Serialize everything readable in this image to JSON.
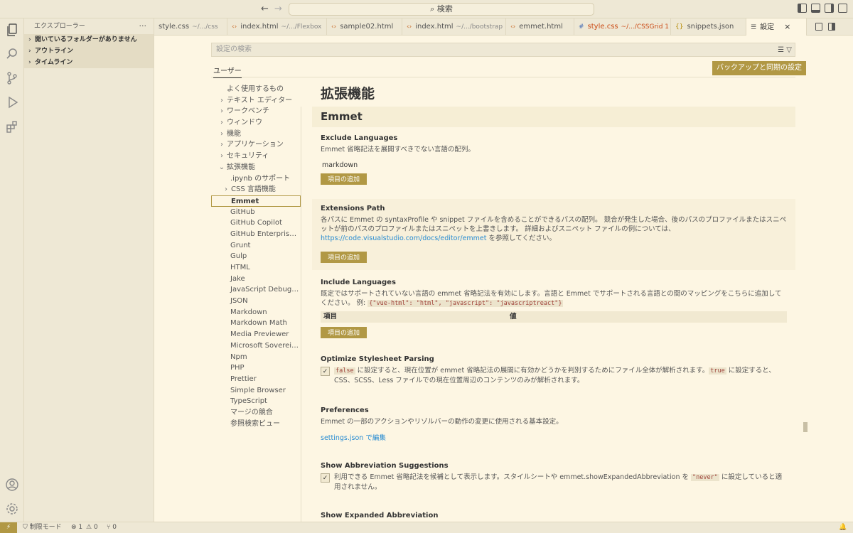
{
  "titlebar": {
    "back_arrow": "←",
    "forward_arrow": "→",
    "search_label": "⌕ 検索"
  },
  "sidebar": {
    "title": "エクスプローラー",
    "more": "···",
    "sections": [
      {
        "label": "開いているフォルダーがありません"
      },
      {
        "label": "アウトライン"
      },
      {
        "label": "タイムライン"
      }
    ]
  },
  "tabs": [
    {
      "icon": "",
      "label": "style.css",
      "path": "~/.../css",
      "status": "normal"
    },
    {
      "icon": "‹›",
      "label": "index.html",
      "path": "~/.../Flexbox",
      "status": "normal"
    },
    {
      "icon": "‹›",
      "label": "sample02.html",
      "path": "",
      "status": "normal"
    },
    {
      "icon": "‹›",
      "label": "index.html",
      "path": "~/.../bootstrap",
      "status": "normal"
    },
    {
      "icon": "‹›",
      "label": "emmet.html",
      "path": "",
      "status": "normal"
    },
    {
      "icon": "#",
      "label": "style.css",
      "path": "~/.../CSSGrid 1",
      "status": "error"
    },
    {
      "icon": "{}",
      "label": "snippets.json",
      "path": "",
      "status": "normal"
    },
    {
      "icon": "☰",
      "label": "設定",
      "path": "",
      "status": "active",
      "close": "×"
    }
  ],
  "settings": {
    "search_placeholder": "設定の検索",
    "user_tab": "ユーザー",
    "backup_button": "バックアップと同期の設定",
    "toc": [
      {
        "label": "よく使用するもの",
        "chevron": "",
        "indent": 0
      },
      {
        "label": "テキスト エディター",
        "chevron": "›",
        "indent": 0
      },
      {
        "label": "ワークベンチ",
        "chevron": "›",
        "indent": 0
      },
      {
        "label": "ウィンドウ",
        "chevron": "›",
        "indent": 0
      },
      {
        "label": "機能",
        "chevron": "›",
        "indent": 0
      },
      {
        "label": "アプリケーション",
        "chevron": "›",
        "indent": 0
      },
      {
        "label": "セキュリティ",
        "chevron": "›",
        "indent": 0
      },
      {
        "label": "拡張機能",
        "chevron": "⌄",
        "indent": 0
      },
      {
        "label": ".ipynb のサポート",
        "chevron": "",
        "indent": 1
      },
      {
        "label": "CSS 言語機能",
        "chevron": "›",
        "indent": 1
      },
      {
        "label": "Emmet",
        "chevron": "",
        "indent": 1,
        "active": true
      },
      {
        "label": "GitHub",
        "chevron": "",
        "indent": 1
      },
      {
        "label": "GitHub Copilot",
        "chevron": "",
        "indent": 1
      },
      {
        "label": "GitHub Enterprise Se...",
        "chevron": "",
        "indent": 1
      },
      {
        "label": "Grunt",
        "chevron": "",
        "indent": 1
      },
      {
        "label": "Gulp",
        "chevron": "",
        "indent": 1
      },
      {
        "label": "HTML",
        "chevron": "",
        "indent": 1
      },
      {
        "label": "Jake",
        "chevron": "",
        "indent": 1
      },
      {
        "label": "JavaScript Debugger",
        "chevron": "",
        "indent": 1
      },
      {
        "label": "JSON",
        "chevron": "",
        "indent": 1
      },
      {
        "label": "Markdown",
        "chevron": "",
        "indent": 1
      },
      {
        "label": "Markdown Math",
        "chevron": "",
        "indent": 1
      },
      {
        "label": "Media Previewer",
        "chevron": "",
        "indent": 1
      },
      {
        "label": "Microsoft Sovereign ...",
        "chevron": "",
        "indent": 1
      },
      {
        "label": "Npm",
        "chevron": "",
        "indent": 1
      },
      {
        "label": "PHP",
        "chevron": "",
        "indent": 1
      },
      {
        "label": "Prettier",
        "chevron": "",
        "indent": 1
      },
      {
        "label": "Simple Browser",
        "chevron": "",
        "indent": 1
      },
      {
        "label": "TypeScript",
        "chevron": "",
        "indent": 1
      },
      {
        "label": "マージの競合",
        "chevron": "",
        "indent": 1
      },
      {
        "label": "参照検索ビュー",
        "chevron": "",
        "indent": 1
      }
    ],
    "heading": "拡張機能",
    "section": "Emmet",
    "exclude": {
      "title": "Exclude Languages",
      "desc": "Emmet 省略記法を展開すべきでない言語の配列。",
      "value": "markdown",
      "button": "項目の追加"
    },
    "extensions_path": {
      "title": "Extensions Path",
      "desc": "各パスに Emmet の syntaxProfile や snippet ファイルを含めることができるパスの配列。 競合が発生した場合、後のパスのプロファイルまたはスニペットが前のパスのプロファイルまたはスニペットを上書きします。 詳細およびスニペット ファイルの例については、",
      "link": "https://code.visualstudio.com/docs/editor/emmet",
      "link_suffix": " を参照してください。",
      "button": "項目の追加"
    },
    "include": {
      "title": "Include Languages",
      "desc": "既定ではサポートされていない言語の emmet 省略記法を有効にします。言語と Emmet でサポートされる言語との間のマッピングをこちらに追加してください。 例: ",
      "example": "{\"vue-html\": \"html\", \"javascript\": \"javascriptreact\"}",
      "col_item": "項目",
      "col_value": "値",
      "button": "項目の追加"
    },
    "optimize": {
      "title": "Optimize Stylesheet Parsing",
      "checked": "✓",
      "code_false": "false",
      "desc_mid": " に設定すると、現在位置が emmet 省略記法の展開に有効かどうかを判別するためにファイル全体が解析されます。",
      "code_true": "true",
      "desc_end": " に設定すると、CSS、SCSS、Less ファイルでの現在位置周辺のコンテンツのみが解析されます。"
    },
    "preferences": {
      "title": "Preferences",
      "desc": "Emmet の一部のアクションやリゾルバーの動作の変更に使用される基本設定。",
      "link": "settings.json で編集"
    },
    "suggestions": {
      "title": "Show Abbreviation Suggestions",
      "checked": "✓",
      "desc_start": "利用できる Emmet 省略記法を候補として表示します。スタイルシートや emmet.showExpandedAbbreviation を ",
      "code": "\"never\"",
      "desc_end": " に設定していると適用されません。"
    },
    "next_title": "Show Expanded Abbreviation"
  },
  "statusbar": {
    "remote": "⚡",
    "restricted": "⛉ 制限モード",
    "errors": "⊗ 1",
    "warnings": "⚠ 0",
    "ports": "⑂ 0",
    "bell": "🔔"
  },
  "colors": {
    "background": "#fdf6e3",
    "sidebar": "#eee8d5",
    "accent_button": "#b19844",
    "link": "#268bd2",
    "error_tab": "#cb4b16"
  }
}
